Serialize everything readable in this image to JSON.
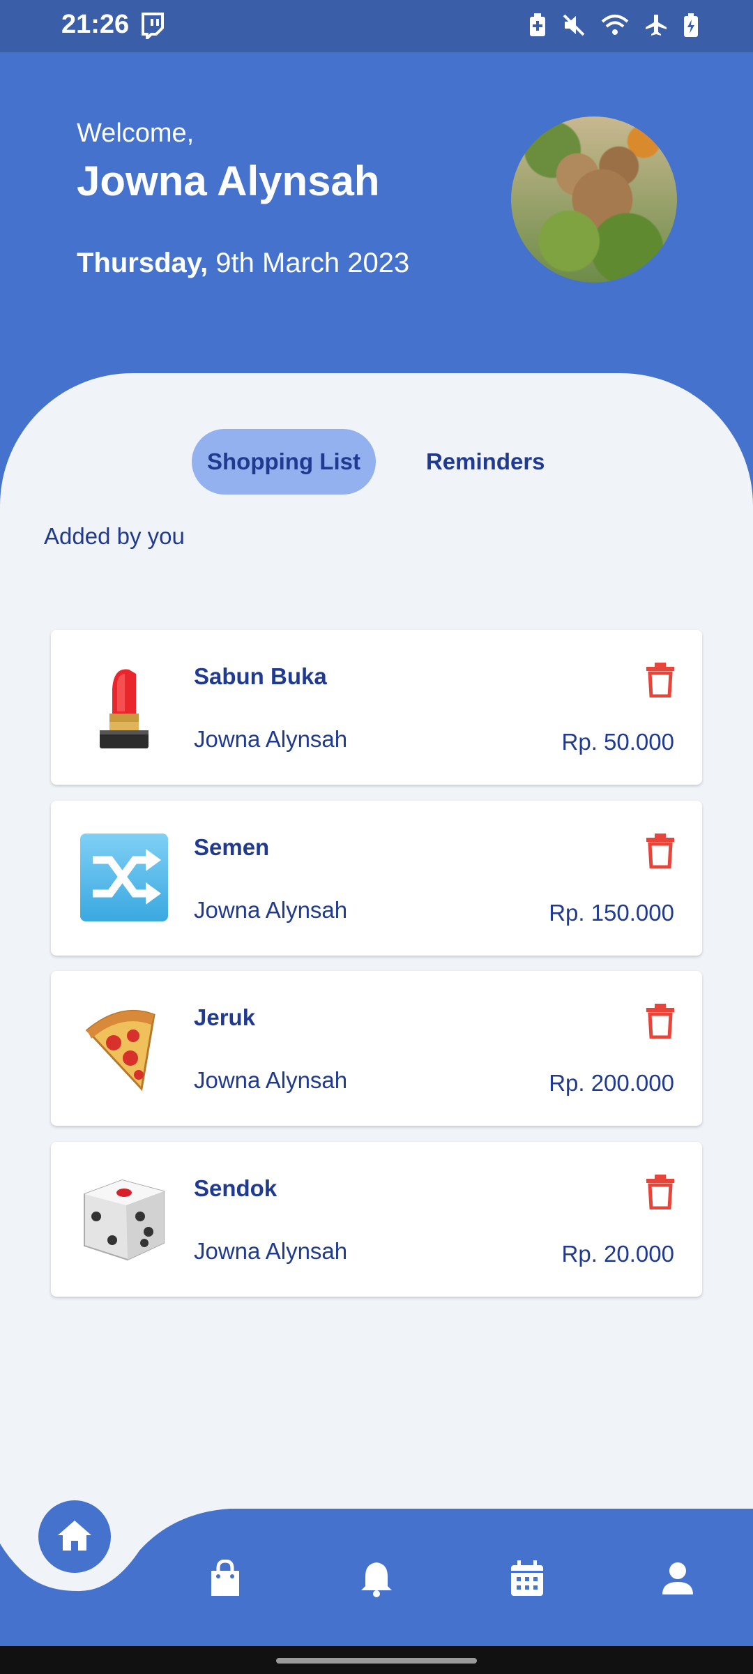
{
  "status_bar": {
    "time": "21:26",
    "icons": [
      "twitch-icon",
      "battery-saver-icon",
      "mute-icon",
      "wifi-icon",
      "airplane-icon",
      "battery-charging-icon"
    ]
  },
  "header": {
    "welcome": "Welcome,",
    "username": "Jowna Alynsah",
    "day": "Thursday,",
    "date": " 9th March 2023"
  },
  "tabs": [
    {
      "label": "Shopping List",
      "active": true
    },
    {
      "label": "Reminders",
      "active": false
    }
  ],
  "section_title": "Added by you",
  "items": [
    {
      "name": "Sabun Buka",
      "owner": "Jowna Alynsah",
      "price": "Rp. 50.000",
      "icon": "lipstick-icon"
    },
    {
      "name": "Semen",
      "owner": "Jowna Alynsah",
      "price": "Rp. 150.000",
      "icon": "shuffle-icon"
    },
    {
      "name": "Jeruk",
      "owner": "Jowna Alynsah",
      "price": "Rp. 200.000",
      "icon": "pizza-icon"
    },
    {
      "name": "Sendok",
      "owner": "Jowna Alynsah",
      "price": "Rp. 20.000",
      "icon": "dice-icon"
    }
  ],
  "nav": [
    "home-icon",
    "shopping-bag-icon",
    "bell-icon",
    "calendar-icon",
    "profile-icon"
  ],
  "colors": {
    "primary": "#4472cc",
    "accent_text": "#1f3a8f",
    "delete": "#e8443a",
    "active_tab": "#93b0ef"
  }
}
